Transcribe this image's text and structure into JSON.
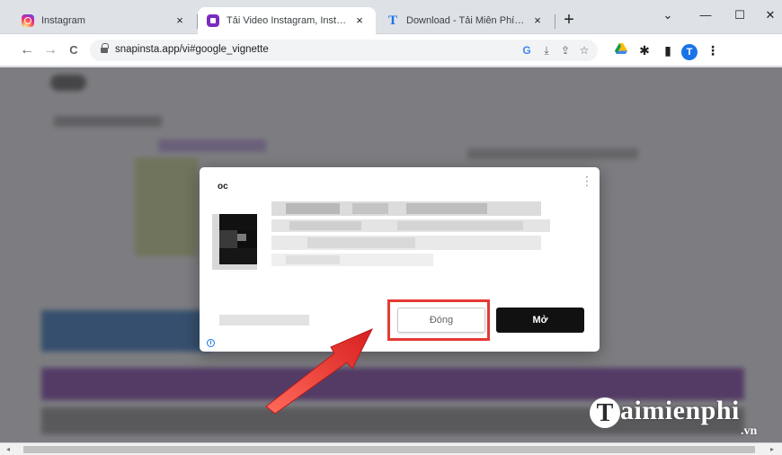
{
  "tabs": [
    {
      "label": "Instagram",
      "favicon": "instagram-icon"
    },
    {
      "label": "Tải Video Instagram, Insta Reels,",
      "favicon": "snapinsta-icon"
    },
    {
      "label": "Download - Tải Miễn Phí VN - Ph",
      "favicon": "taimienphi-icon"
    }
  ],
  "tab_close_glyph": "×",
  "new_tab_glyph": "+",
  "window_controls": {
    "dropdown": "⌄",
    "minimize": "—",
    "maximize": "☐",
    "close": "✕"
  },
  "toolbar": {
    "back": "←",
    "forward": "→",
    "reload": "C",
    "url": "snapinsta.app/vi#google_vignette",
    "profile_initial": "T"
  },
  "dialog": {
    "advertiser": "oc",
    "kebab": "⋮",
    "close_button": "Đóng",
    "open_button": "Mở",
    "info": "i"
  },
  "watermark": {
    "logo_letter": "T",
    "brand": "aimienphi",
    "tld": ".vn"
  },
  "colors": {
    "highlight": "#e53935",
    "arrow": "#e53935",
    "open_button_bg": "#111111",
    "ad_strip_purple": "#7b3aa0",
    "ad_strip_blue": "#2d6fb8"
  }
}
